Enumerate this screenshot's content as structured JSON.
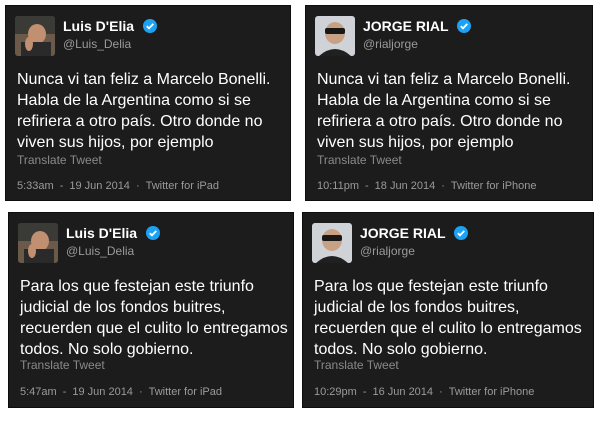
{
  "tweets": [
    {
      "name": "Luis D'Elia",
      "handle": "@Luis_Delia",
      "text": "Nunca vi tan feliz a Marcelo Bonelli. Habla de la Argentina como si se refiriera a otro país. Otro donde no viven sus hijos, por ejemplo",
      "translate": "Translate Tweet",
      "time": "5:33am",
      "date": "19 Jun 2014",
      "client": "Twitter for iPad"
    },
    {
      "name": "JORGE RIAL",
      "handle": "@rialjorge",
      "text": "Nunca vi tan feliz a Marcelo Bonelli. Habla de la Argentina como si se refiriera a otro país. Otro donde no viven sus hijos, por ejemplo",
      "translate": "Translate Tweet",
      "time": "10:11pm",
      "date": "18 Jun 2014",
      "client": "Twitter for iPhone"
    },
    {
      "name": "Luis D'Elia",
      "handle": "@Luis_Delia",
      "text": "Para los que festejan este triunfo judicial de los fondos buitres, recuerden que el culito lo entregamos todos. No solo gobierno.",
      "translate": "Translate Tweet",
      "time": "5:47am",
      "date": "19 Jun 2014",
      "client": "Twitter for iPad"
    },
    {
      "name": "JORGE RIAL",
      "handle": "@rialjorge",
      "text": "Para los que festejan este triunfo judicial de los fondos buitres, recuerden que el culito lo entregamos todos. No solo gobierno.",
      "translate": "Translate Tweet",
      "time": "10:29pm",
      "date": "16 Jun 2014",
      "client": "Twitter for iPhone"
    }
  ],
  "colors": {
    "card_bg": "#1c1c1c",
    "verified": "#1da1f2",
    "muted": "#9a9a9a"
  },
  "icons": {
    "verified": "verified-badge-icon"
  }
}
